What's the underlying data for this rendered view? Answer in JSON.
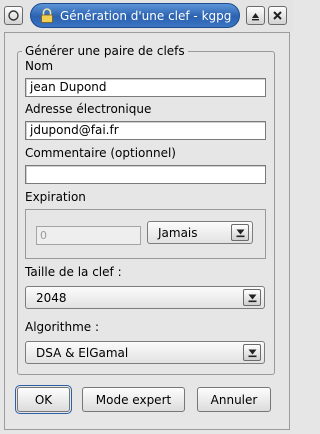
{
  "window": {
    "title": "Génération d'une clef - kgpg",
    "icons": {
      "menu": "window-menu-icon",
      "lock": "lock-icon",
      "maximize": "maximize-icon",
      "close": "close-icon"
    }
  },
  "group": {
    "legend": "Générer une paire de clefs"
  },
  "name": {
    "label": "Nom",
    "value": "jean Dupond"
  },
  "email": {
    "label": "Adresse électronique",
    "value": "jdupond@fai.fr"
  },
  "comment": {
    "label": "Commentaire (optionnel)",
    "value": ""
  },
  "expiration": {
    "label": "Expiration",
    "value": "0",
    "unit": "Jamais"
  },
  "keysize": {
    "label": "Taille de la clef :",
    "value": "2048"
  },
  "algorithm": {
    "label": "Algorithme :",
    "value": "DSA & ElGamal"
  },
  "buttons": {
    "ok": "OK",
    "expert": "Mode expert",
    "cancel": "Annuler"
  },
  "colors": {
    "title_accent": "#2b62b0",
    "background": "#e6e6e6"
  }
}
